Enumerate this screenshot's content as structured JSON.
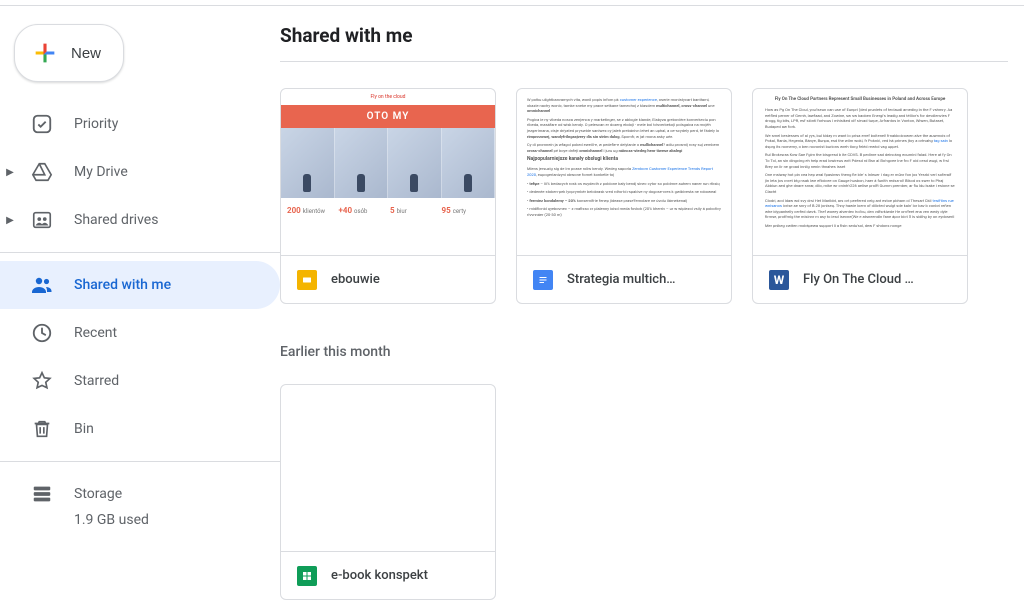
{
  "header": {
    "new_label": "New"
  },
  "sidebar": {
    "items": [
      {
        "label": "Priority"
      },
      {
        "label": "My Drive"
      },
      {
        "label": "Shared drives"
      },
      {
        "label": "Shared with me"
      },
      {
        "label": "Recent"
      },
      {
        "label": "Starred"
      },
      {
        "label": "Bin"
      }
    ],
    "storage_label": "Storage",
    "storage_used": "1.9 GB used"
  },
  "main": {
    "title": "Shared with me",
    "section_earlier": "Earlier this month",
    "files_recent": [
      {
        "name": "ebouwie",
        "type": "slides"
      },
      {
        "name": "Strategia multich…",
        "type": "docs"
      },
      {
        "name": "Fly On The Cloud …",
        "type": "word"
      }
    ],
    "files_earlier": [
      {
        "name": "e-book konspekt",
        "type": "sheets"
      }
    ],
    "preview_slides": {
      "brand": "Fly on the cloud",
      "banner": "OTO MY",
      "stats": [
        {
          "num": "200",
          "unit": "klientów"
        },
        {
          "num": "+40",
          "unit": "osób"
        },
        {
          "num": "5",
          "unit": "biur"
        },
        {
          "num": "95",
          "unit": "certy"
        }
      ]
    },
    "preview_doc1": {
      "heading": "Najpopularniejsze kanały obsługi klienta"
    },
    "preview_doc2": {
      "title": "Fly On The Cloud Partners Represent Small Businesses in Poland and Across Europe"
    }
  },
  "colors": {
    "blue": "#1967d2",
    "slides": "#f4b400",
    "docs": "#4285f4",
    "word": "#2b579a",
    "sheets": "#0f9d58"
  }
}
